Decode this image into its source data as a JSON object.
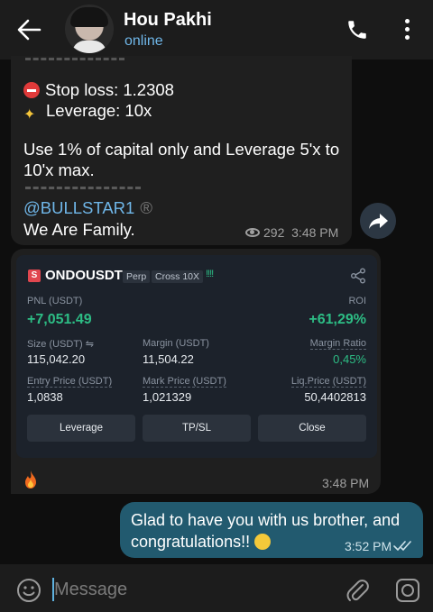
{
  "header": {
    "name": "Hou Pakhi",
    "status": "online"
  },
  "message1": {
    "stop_loss": "Stop loss: 1.2308",
    "leverage": "Leverage: 10x",
    "capital_line1": "Use 1% of capital only and Leverage 5'x to",
    "capital_line2": "10'x max.",
    "handle": "@BULLSTAR1",
    "reg": "®",
    "family": "We Are Family.",
    "views": "292",
    "time": "3:48 PM"
  },
  "card": {
    "icon_letter": "S",
    "ticker": "ONDOUSDT",
    "tag_perp": "Perp",
    "tag_cross": "Cross 10X",
    "bars": "!!!!",
    "pnl_label": "PNL (USDT)",
    "pnl_value": "+7,051.49",
    "roi_label": "ROI",
    "roi_value": "+61,29%",
    "size_label": "Size (USDT) ⇋",
    "size_value": "115,042.20",
    "margin_label": "Margin (USDT)",
    "margin_value": "11,504.22",
    "margin_ratio_label": "Margin Ratio",
    "margin_ratio_value": "0,45%",
    "entry_label": "Entry Price (USDT)",
    "entry_value": "1,0838",
    "mark_label": "Mark Price (USDT)",
    "mark_value": "1,021329",
    "liq_label": "Liq.Price (USDT)",
    "liq_value": "50,4402813",
    "btn_leverage": "Leverage",
    "btn_tpsl": "TP/SL",
    "btn_close": "Close"
  },
  "message2": {
    "time": "3:48 PM"
  },
  "message3": {
    "text": "Glad to have you with us brother, and congratulations!!",
    "time": "3:52 PM"
  },
  "input": {
    "placeholder": "Message"
  },
  "colors": {
    "accent": "#6fb6e8",
    "green": "#2dbd85",
    "outgoing": "#225a6f"
  }
}
